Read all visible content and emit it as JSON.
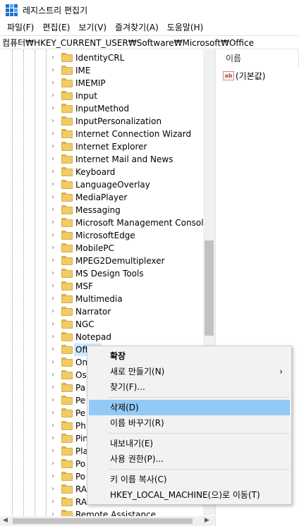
{
  "window": {
    "title": "레지스트리 편집기"
  },
  "menu": [
    "파일(F)",
    "편집(E)",
    "보기(V)",
    "즐겨찾기(A)",
    "도움말(H)"
  ],
  "address": "컴퓨터₩HKEY_CURRENT_USER₩Software₩Microsoft₩Office",
  "tree": {
    "items": [
      "IdentityCRL",
      "IME",
      "IMEMIP",
      "Input",
      "InputMethod",
      "InputPersonalization",
      "Internet Connection Wizard",
      "Internet Explorer",
      "Internet Mail and News",
      "Keyboard",
      "LanguageOverlay",
      "MediaPlayer",
      "Messaging",
      "Microsoft Management Console",
      "MicrosoftEdge",
      "MobilePC",
      "MPEG2Demultiplexer",
      "MS Design Tools",
      "MSF",
      "Multimedia",
      "Narrator",
      "NGC",
      "Notepad",
      "Office",
      "On",
      "Os",
      "Pa",
      "Pe",
      "Pe",
      "Ph",
      "Pin",
      "Pla",
      "Po",
      "Po",
      "RA",
      "RA",
      "Remote Assistance"
    ],
    "selected_index": 23
  },
  "values": {
    "header_name": "이름",
    "rows": [
      {
        "name": "(기본값)",
        "icon": "string-value-icon"
      }
    ]
  },
  "context_menu": {
    "items": [
      {
        "label": "확장",
        "bold": true
      },
      {
        "label": "새로 만들기(N)",
        "submenu": true
      },
      {
        "label": "찾기(F)..."
      },
      {
        "label": "삭제(D)",
        "hover": true
      },
      {
        "label": "이름 바꾸기(R)"
      },
      {
        "label": "내보내기(E)"
      },
      {
        "label": "사용 권한(P)..."
      },
      {
        "label": "키 이름 복사(C)"
      },
      {
        "label": "HKEY_LOCAL_MACHINE(으)로 이동(T)"
      }
    ],
    "submenu_arrow": "›"
  },
  "colors": {
    "hover": "#91c9f7",
    "selection": "#cce8ff",
    "folder": "#f2cb66"
  }
}
